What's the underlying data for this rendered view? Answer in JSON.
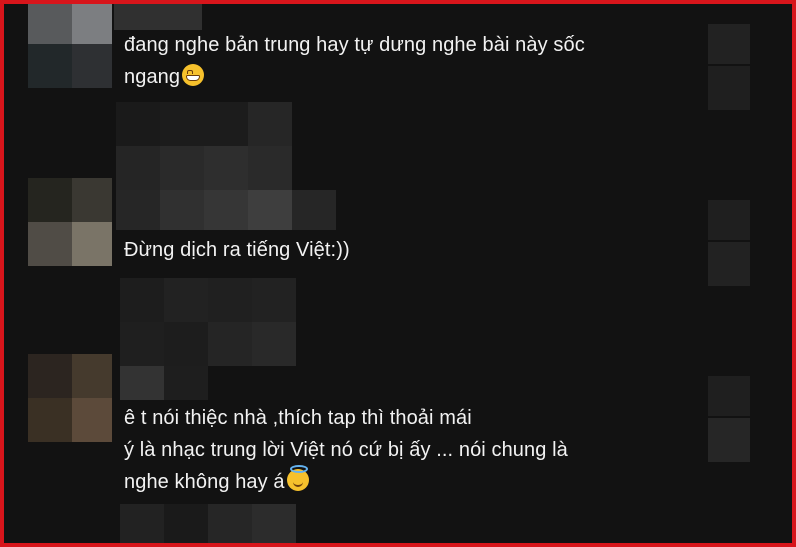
{
  "comments": [
    {
      "lines": [
        "đang nghe bản trung hay tự dưng nghe bài này sốc",
        "ngang"
      ],
      "emoji": "grinning-face-icon"
    },
    {
      "lines": [
        "Đừng dịch ra tiếng Việt:))"
      ]
    },
    {
      "lines": [
        "ê t nói thiệc nhà ,thích tap thì thoải mái",
        "ý là nhạc trung lời Việt nó cứ bị ấy ... nói chung là",
        "nghe không hay á"
      ],
      "emoji": "smiling-face-with-halo-icon"
    }
  ],
  "colors": {
    "background": "#121212",
    "text": "#f2f2f2",
    "frame_border": "#d7151b"
  }
}
